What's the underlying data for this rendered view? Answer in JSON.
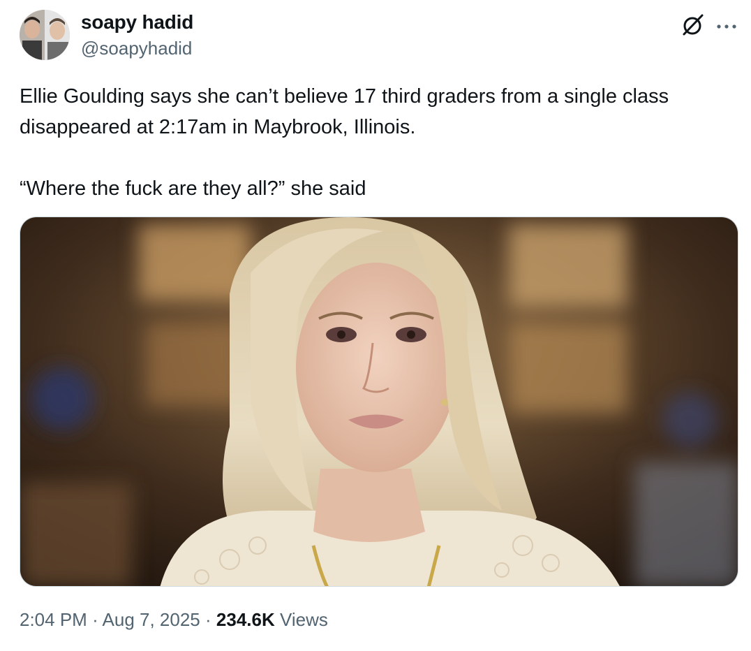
{
  "author": {
    "display_name": "soapy hadid",
    "handle": "@soapyhadid",
    "avatar_icon": "profile-photo"
  },
  "actions": {
    "grok_icon": "grok-icon",
    "more_icon": "more-icon"
  },
  "tweet": {
    "paragraph_1": "Ellie Goulding says she can’t believe 17 third graders from a single class disappeared at 2:17am in Maybrook, Illinois.",
    "paragraph_2": "“Where the fuck are they all?” she said"
  },
  "media": {
    "type": "photo"
  },
  "footer": {
    "time": "2:04 PM",
    "separator_1": "·",
    "date": "Aug 7, 2025",
    "separator_2": "·",
    "views_count": "234.6K",
    "views_label": "Views"
  },
  "colors": {
    "text_primary": "#0f1419",
    "text_secondary": "#536471",
    "border": "#cfd9de"
  }
}
